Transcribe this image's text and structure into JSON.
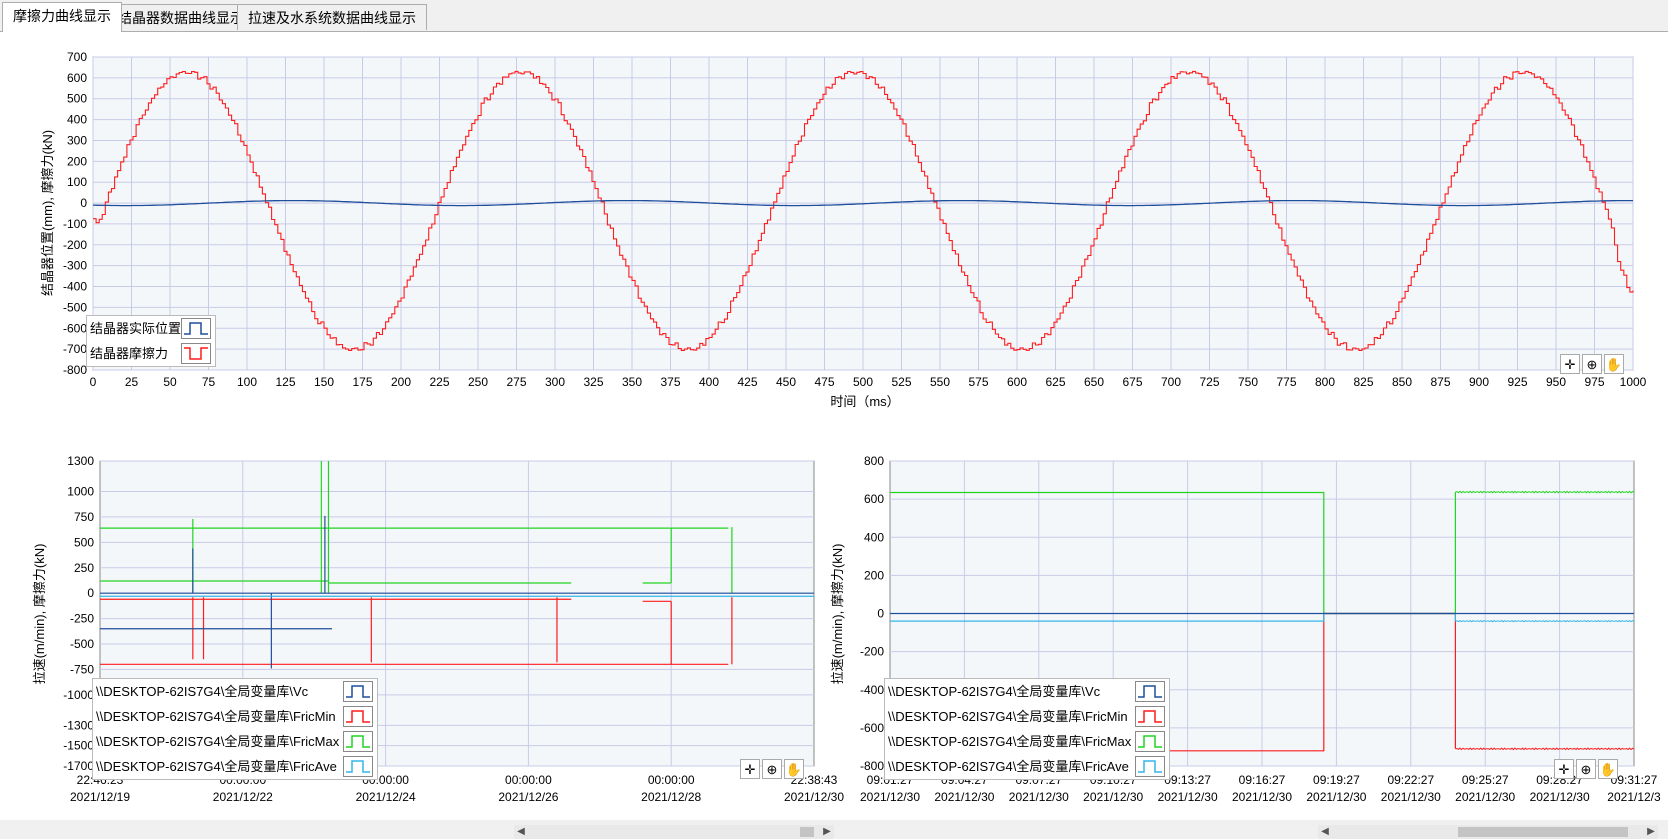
{
  "tabs": [
    {
      "label": "摩擦力曲线显示",
      "active": true
    },
    {
      "label": "结晶器数据曲线显示",
      "active": false
    },
    {
      "label": "拉速及水系统数据曲线显示",
      "active": false
    }
  ],
  "colors": {
    "blue": "#1f4e9c",
    "red": "#ff1c1c",
    "green": "#21d421",
    "cyan": "#33b5e8",
    "grid": "#c8cbe8",
    "plot_bg": "#f4f7f9"
  },
  "top_chart": {
    "ylabel": "结晶器位置(mm), 摩擦力(kN)",
    "xlabel": "时间（ms）",
    "legend": [
      {
        "label": "结晶器实际位置",
        "color": "#1f4e9c"
      },
      {
        "label": "结晶器摩擦力",
        "color": "#ff1c1c"
      }
    ]
  },
  "bottom_left_chart": {
    "ylabel": "拉速(m/min), 摩擦力(kN)",
    "x_ticks": [
      {
        "time": "22:46:23",
        "date": "2021/12/19"
      },
      {
        "time": "00:00:00",
        "date": "2021/12/22"
      },
      {
        "time": "00:00:00",
        "date": "2021/12/24"
      },
      {
        "time": "00:00:00",
        "date": "2021/12/26"
      },
      {
        "time": "00:00:00",
        "date": "2021/12/28"
      },
      {
        "time": "22:38:43",
        "date": "2021/12/30"
      }
    ],
    "legend": [
      {
        "label": "\\\\DESKTOP-62IS7G4\\全局变量库\\Vc",
        "color": "#1f4e9c"
      },
      {
        "label": "\\\\DESKTOP-62IS7G4\\全局变量库\\FricMin",
        "color": "#ff1c1c"
      },
      {
        "label": "\\\\DESKTOP-62IS7G4\\全局变量库\\FricMax",
        "color": "#21d421"
      },
      {
        "label": "\\\\DESKTOP-62IS7G4\\全局变量库\\FricAve",
        "color": "#33b5e8"
      }
    ]
  },
  "bottom_right_chart": {
    "ylabel": "拉速(m/min), 摩擦力(kN)",
    "x_ticks": [
      {
        "time": "09:01:27",
        "date": "2021/12/30"
      },
      {
        "time": "09:04:27",
        "date": "2021/12/30"
      },
      {
        "time": "09:07:27",
        "date": "2021/12/30"
      },
      {
        "time": "09:10:27",
        "date": "2021/12/30"
      },
      {
        "time": "09:13:27",
        "date": "2021/12/30"
      },
      {
        "time": "09:16:27",
        "date": "2021/12/30"
      },
      {
        "time": "09:19:27",
        "date": "2021/12/30"
      },
      {
        "time": "09:22:27",
        "date": "2021/12/30"
      },
      {
        "time": "09:25:27",
        "date": "2021/12/30"
      },
      {
        "time": "09:28:27",
        "date": "2021/12/30"
      },
      {
        "time": "09:31:27",
        "date": "2021/12/3"
      }
    ],
    "legend": [
      {
        "label": "\\\\DESKTOP-62IS7G4\\全局变量库\\Vc",
        "color": "#1f4e9c"
      },
      {
        "label": "\\\\DESKTOP-62IS7G4\\全局变量库\\FricMin",
        "color": "#ff1c1c"
      },
      {
        "label": "\\\\DESKTOP-62IS7G4\\全局变量库\\FricMax",
        "color": "#21d421"
      },
      {
        "label": "\\\\DESKTOP-62IS7G4\\全局变量库\\FricAve",
        "color": "#33b5e8"
      }
    ]
  },
  "chart_data": [
    {
      "type": "line",
      "xlim": [
        0,
        1000
      ],
      "ylim": [
        -800,
        700
      ],
      "x_tick_labels": [
        "0",
        "25",
        "50",
        "75",
        "100",
        "125",
        "150",
        "175",
        "200",
        "225",
        "250",
        "275",
        "300",
        "325",
        "350",
        "375",
        "400",
        "425",
        "450",
        "475",
        "500",
        "525",
        "550",
        "575",
        "600",
        "625",
        "650",
        "675",
        "700",
        "725",
        "750",
        "775",
        "800",
        "825",
        "850",
        "875",
        "900",
        "925",
        "950",
        "975",
        "1000"
      ],
      "y_tick_labels": [
        "700",
        "600",
        "500",
        "400",
        "300",
        "200",
        "100",
        "0",
        "-100",
        "-200",
        "-300",
        "-400",
        "-500",
        "-600",
        "-700",
        "-800"
      ],
      "grid": true,
      "legend_position": "bottom-left",
      "series": [
        {
          "name": "结晶器实际位置",
          "model": "sine",
          "amplitude": 12,
          "period": 217,
          "peak_x": 60
        },
        {
          "name": "结晶器摩擦力",
          "model": "sine",
          "amplitude": 665,
          "offset": -35,
          "period": 217,
          "peak_x": 60,
          "start_y": -85,
          "end_y": -430
        }
      ]
    },
    {
      "type": "line",
      "ylim": [
        -1700,
        1300
      ],
      "y_tick_labels": [
        "1300",
        "1000",
        "750",
        "500",
        "250",
        "0",
        "-250",
        "-500",
        "-750",
        "-1000",
        "-1300",
        "-1500",
        "-1700"
      ],
      "grid": true,
      "legend_position": "bottom-left",
      "series": [
        {
          "name": "\\\\DESKTOP-62IS7G4\\全局变量库\\Vc",
          "values": [
            0
          ]
        },
        {
          "name": "\\\\DESKTOP-62IS7G4\\全局变量库\\FricMin",
          "values": [
            -700,
            -60
          ]
        },
        {
          "name": "\\\\DESKTOP-62IS7G4\\全局变量库\\FricMax",
          "values": [
            640,
            120
          ]
        },
        {
          "name": "\\\\DESKTOP-62IS7G4\\全局变量库\\FricAve",
          "values": [
            -30
          ]
        }
      ]
    },
    {
      "type": "line",
      "ylim": [
        -800,
        800
      ],
      "y_tick_labels": [
        "800",
        "600",
        "400",
        "200",
        "0",
        "-200",
        "-400",
        "-600",
        "-800"
      ],
      "grid": true,
      "legend_position": "bottom-left",
      "series": [
        {
          "name": "\\\\DESKTOP-62IS7G4\\全局变量库\\Vc",
          "values": [
            0,
            0,
            0
          ]
        },
        {
          "name": "\\\\DESKTOP-62IS7G4\\全局变量库\\FricMin",
          "values": [
            -720,
            0,
            -710
          ]
        },
        {
          "name": "\\\\DESKTOP-62IS7G4\\全局变量库\\FricMax",
          "values": [
            635,
            0,
            637
          ]
        },
        {
          "name": "\\\\DESKTOP-62IS7G4\\全局变量库\\FricAve",
          "values": [
            -40,
            0,
            -40
          ]
        }
      ]
    }
  ]
}
